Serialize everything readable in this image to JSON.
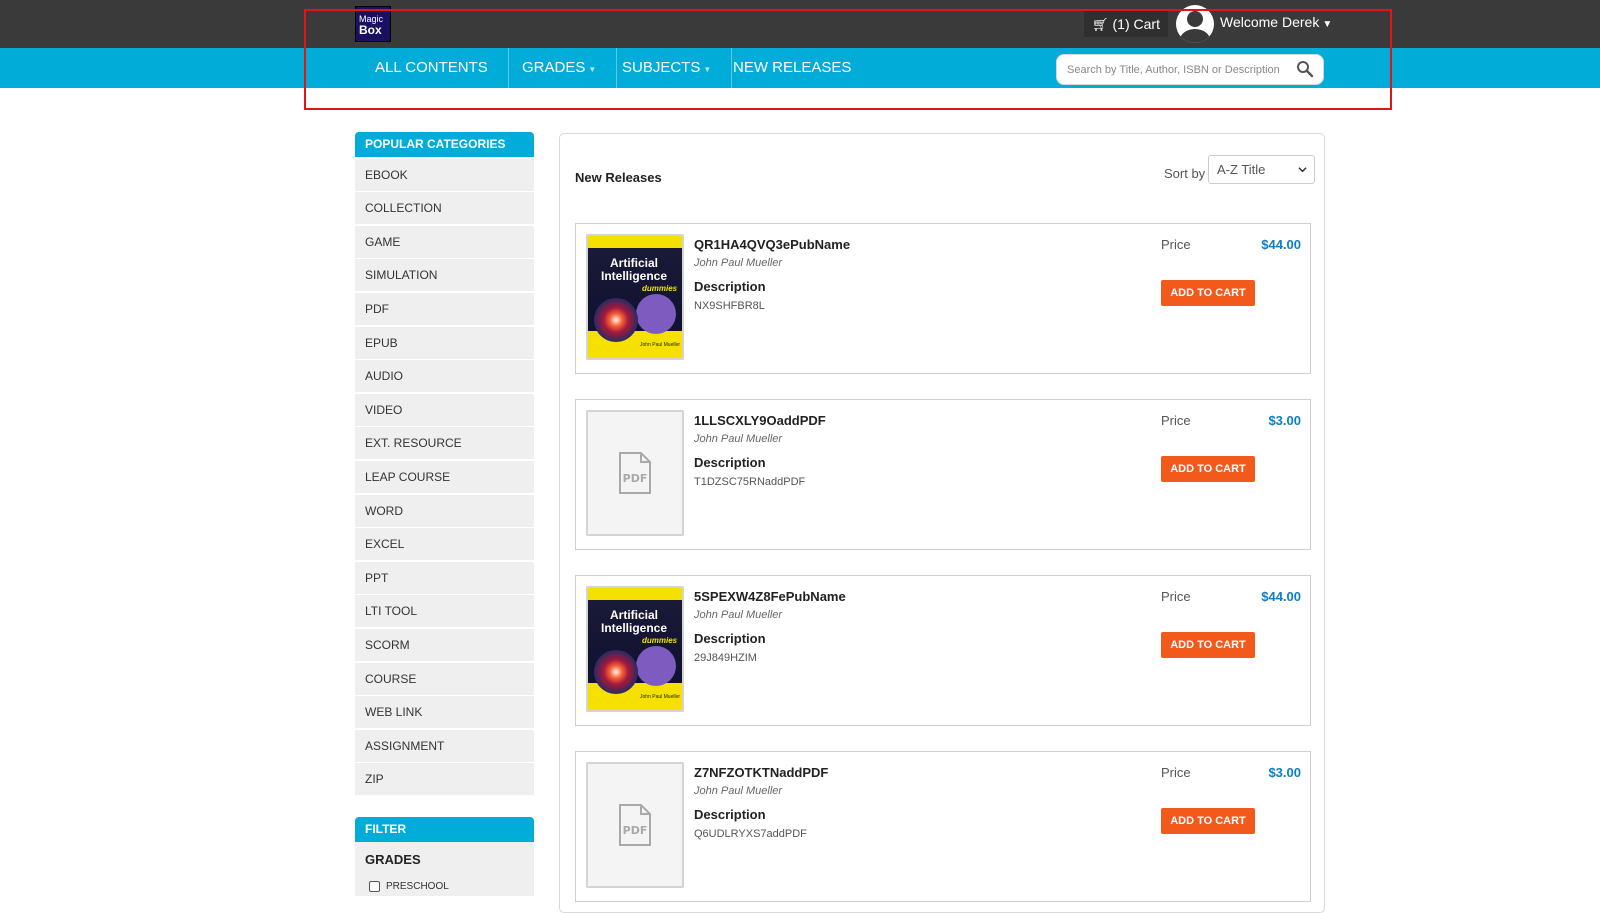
{
  "header": {
    "logo": {
      "line1": "Magic",
      "line2": "Box"
    },
    "cart_label": "(1) Cart",
    "welcome": "Welcome Derek"
  },
  "nav": {
    "items": [
      "ALL CONTENTS",
      "GRADES",
      "SUBJECTS",
      "NEW RELEASES"
    ],
    "search_placeholder": "Search by Title, Author, ISBN or Description"
  },
  "sidebar": {
    "popular_title": "POPULAR CATEGORIES",
    "categories": [
      "EBOOK",
      "COLLECTION",
      "GAME",
      "SIMULATION",
      "PDF",
      "EPUB",
      "AUDIO",
      "VIDEO",
      "EXT. RESOURCE",
      "LEAP COURSE",
      "WORD",
      "EXCEL",
      "PPT",
      "LTI TOOL",
      "SCORM",
      "COURSE",
      "WEB LINK",
      "ASSIGNMENT",
      "ZIP"
    ],
    "filter_title": "FILTER",
    "filter_grades_label": "GRADES",
    "filter_grades_first": "PRESCHOOL"
  },
  "main": {
    "title": "New Releases",
    "sort_label": "Sort by",
    "sort_value": "A-Z Title",
    "price_label": "Price",
    "desc_label": "Description",
    "add_label": "ADD TO CART",
    "products": [
      {
        "title": "QR1HA4QVQ3ePubName",
        "author": "John Paul Mueller",
        "description": "NX9SHFBR8L",
        "price": "$44.00",
        "cover": "ai-dummies"
      },
      {
        "title": "1LLSCXLY9OaddPDF",
        "author": "John Paul Mueller",
        "description": "T1DZSC75RNaddPDF",
        "price": "$3.00",
        "cover": "pdf"
      },
      {
        "title": "5SPEXW4Z8FePubName",
        "author": "John Paul Mueller",
        "description": "29J849HZIM",
        "price": "$44.00",
        "cover": "ai-dummies"
      },
      {
        "title": "Z7NFZOTKTNaddPDF",
        "author": "John Paul Mueller",
        "description": "Q6UDLRYXS7addPDF",
        "price": "$3.00",
        "cover": "pdf"
      }
    ],
    "ebook_cover": {
      "line1": "Artificial",
      "line2": "Intelligence",
      "brand": "dummies",
      "authors": "John Paul Mueller"
    }
  },
  "colors": {
    "topbar": "#3a3a3a",
    "nav": "#01acd8",
    "button": "#f25a1b",
    "price": "#0b7fc4",
    "highlight": "#e01616"
  }
}
